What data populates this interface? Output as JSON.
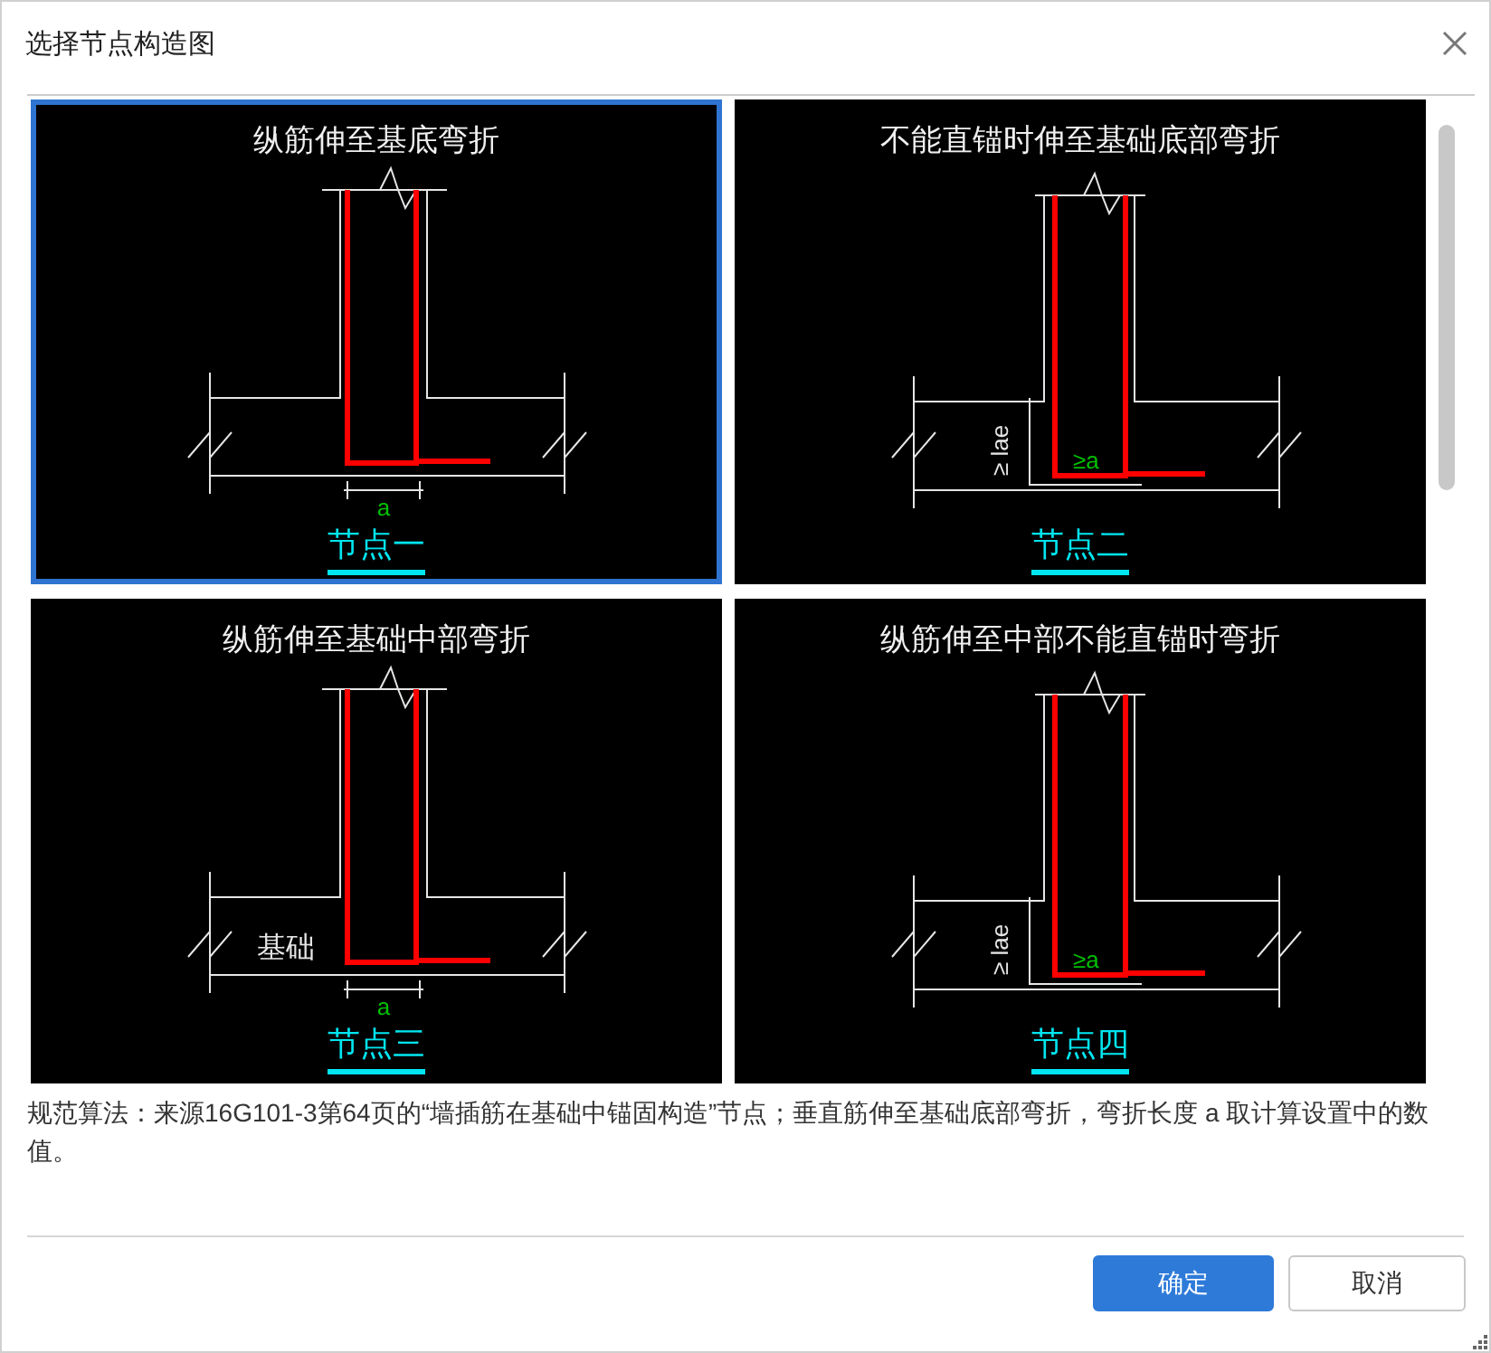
{
  "window": {
    "title": "选择节点构造图"
  },
  "nodes": [
    {
      "title": "纵筋伸至基底弯折",
      "kind": "bend",
      "caption": "节点一",
      "selected": true,
      "labels": [
        {
          "kind": "dim-a",
          "text": "a"
        }
      ]
    },
    {
      "title": "不能直锚时伸至基础底部弯折",
      "kind": "lae",
      "caption": "节点二",
      "selected": false,
      "labels": [
        {
          "kind": "lae",
          "text": "≥ lae"
        },
        {
          "kind": "ge-a",
          "text": "≥a"
        }
      ]
    },
    {
      "title": "纵筋伸至基础中部弯折",
      "kind": "bend",
      "caption": "节点三",
      "selected": false,
      "labels": [
        {
          "kind": "base",
          "text": "基础"
        },
        {
          "kind": "dim-a",
          "text": "a"
        }
      ]
    },
    {
      "title": "纵筋伸至中部不能直锚时弯折",
      "kind": "lae",
      "caption": "节点四",
      "selected": false,
      "labels": [
        {
          "kind": "lae",
          "text": "≥ lae"
        },
        {
          "kind": "ge-a",
          "text": "≥a"
        }
      ]
    }
  ],
  "description": "规范算法：来源16G101-3第64页的“墙插筋在基础中锚固构造”节点；垂直筋伸至基础底部弯折，弯折长度 a 取计算设置中的数值。",
  "buttons": [
    {
      "label": "确定",
      "kind": "primary"
    },
    {
      "label": "取消",
      "kind": "secondary"
    }
  ]
}
